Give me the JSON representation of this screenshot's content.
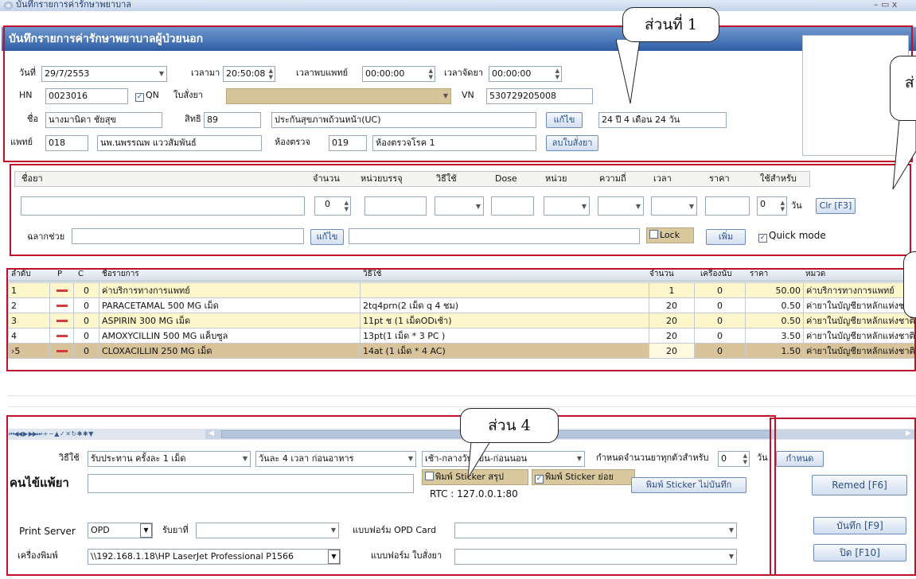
{
  "window": {
    "title": "บันทึกรายการค่ารักษาพยาบาล",
    "controls": "– ▭ x"
  },
  "header": {
    "title": "บันทึกรายการค่ารักษาพยาบาลผู้ป่วยนอก"
  },
  "callouts": {
    "c1": "ส่วนที่ 1",
    "c2": "ส่",
    "c4": "ส่วน 4"
  },
  "visit": {
    "date_label": "วันที่",
    "date": "29/7/2553",
    "time_label": "เวลามา",
    "time": "20:50:08",
    "doctor_time_label": "เวลาพบแพทย์",
    "doctor_time": "00:00:00",
    "dispense_time_label": "เวลาจัดยา",
    "dispense_time": "00:00:00",
    "hn_label": "HN",
    "hn": "0023016",
    "qn_label": "QN",
    "order_label": "ใบสั่งยา",
    "vn_label": "VN",
    "vn": "530729205008",
    "name_label": "ชื่อ",
    "name": "นางมานิดา ชัยสุข",
    "right_label": "สิทธิ",
    "right_code": "89",
    "right_name": "ประกันสุขภาพถ้วนหน้า(UC)",
    "edit_button": "แก้ไข",
    "age": "24 ปี 4 เดือน 24 วัน",
    "doctor_label": "แพทย์",
    "doctor_code": "018",
    "doctor_name": "นพ.นพรรณพ แววสัมพันธ์",
    "room_label": "ห้องตรวจ",
    "room_code": "019",
    "room_name": "ห้องตรวจโรค 1",
    "delete_order_button": "ลบใบสั่งยา"
  },
  "entry": {
    "headers": [
      "ชื่อยา",
      "จำนวน",
      "หน่วยบรรจุ",
      "วิธีใช้",
      "Dose",
      "หน่วย",
      "ความถี่",
      "เวลา",
      "ราคา",
      "ใช้สำหรับ"
    ],
    "qty": "0",
    "days": "0",
    "days_unit": "วัน",
    "clear_button": "Clr [F3]",
    "aux_label": "ฉลากช่วย",
    "edit_button": "แก้ไข",
    "lock_label": "Lock",
    "add_button": "เพิ่ม",
    "quick_mode_label": "Quick mode"
  },
  "list": {
    "columns": [
      "ลำดับ",
      "P",
      "C",
      "ชื่อรายการ",
      "วิธีใช้",
      "จำนวน",
      "เครื่องนับ",
      "ราคา",
      "หมวด"
    ],
    "rows": [
      {
        "no": "1",
        "c": "0",
        "name": "ค่าบริการทางการแพทย์",
        "usage": "",
        "qty": "1",
        "counter": "0",
        "price": "50.00",
        "cat": "ค่าบริการทางการแพทย์"
      },
      {
        "no": "2",
        "c": "0",
        "name": "PARACETAMAL 500 MG เม็ด",
        "usage": "2tq4prn(2 เม็ด q 4 ชม)",
        "qty": "20",
        "counter": "0",
        "price": "0.50",
        "cat": "ค่ายาในบัญชียาหลักแห่งชาติ"
      },
      {
        "no": "3",
        "c": "0",
        "name": "ASPIRIN 300 MG เม็ด",
        "usage": "11pt ช (1 เม็ดODเช้า)",
        "qty": "20",
        "counter": "0",
        "price": "0.50",
        "cat": "ค่ายาในบัญชียาหลักแห่งชาติ"
      },
      {
        "no": "4",
        "c": "0",
        "name": "AMOXYCILLIN 500 MG แค็บซูล",
        "usage": "13pt(1 เม็ด * 3 PC )",
        "qty": "20",
        "counter": "0",
        "price": "3.50",
        "cat": "ค่ายาในบัญชียาหลักแห่งชาติ"
      },
      {
        "no": "5",
        "c": "0",
        "name": "CLOXACILLIN 250 MG เม็ด",
        "usage": "14at (1 เม็ด * 4 AC)",
        "qty": "20",
        "counter": "0",
        "price": "1.50",
        "cat": "ค่ายาในบัญชียาหลักแห่งชาติ"
      }
    ]
  },
  "nav": {
    "symbols": "⏮◀◀ ▶ ▶▶⏭ + − ▲ ✓ ✕ ↻ ✱ ✱ ▼"
  },
  "usage": {
    "label": "วิธีใช้",
    "method": "รับประทาน ครั้งละ 1 เม็ด",
    "freq": "วันละ 4 เวลา ก่อนอาหาร",
    "times": "เช้า-กลางวัน-เย็น-ก่อนนอน",
    "fix_qty_label": "กำหนดจำนวนยาทุกตัวสำหรับ",
    "fix_days": "0",
    "days_unit": "วัน",
    "set_button": "กำหนด",
    "allergy_label": "คนไข้แพ้ยา",
    "sticker_summary": "พิมพ์ Sticker สรุป",
    "sticker_sub": "พิมพ์ Sticker ย่อย",
    "sticker_nosave_button": "พิมพ์ Sticker ไม่บันทึก",
    "rtc": "RTC : 127.0.0.1:80"
  },
  "print": {
    "server_label": "Print Server",
    "server": "OPD",
    "receive_label": "รับยาที่",
    "opd_card_label": "แบบฟอร์ม OPD Card",
    "printer_label": "เครื่องพิมพ์",
    "printer": "\\\\192.168.1.18\\HP LaserJet Professional P1566",
    "order_form_label": "แบบฟอร์ม ใบสั่งยา"
  },
  "actions": {
    "remed": "Remed [F6]",
    "save": "บันทึก [F9]",
    "close": "ปิด [F10]"
  }
}
